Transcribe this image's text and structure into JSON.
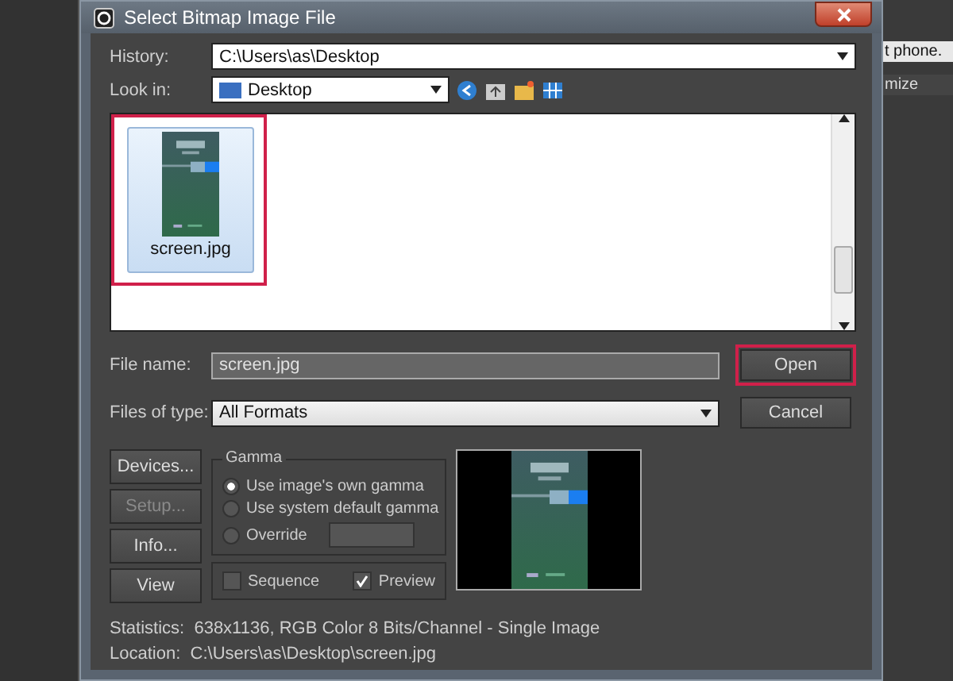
{
  "background_app": {
    "title_fragment": "t phone.",
    "panel_label": "mize"
  },
  "window": {
    "title": "Select Bitmap Image File"
  },
  "history": {
    "label": "History:",
    "value": "C:\\Users\\as\\Desktop"
  },
  "look_in": {
    "label": "Look in:",
    "value": "Desktop"
  },
  "files": [
    {
      "name": "screen.jpg",
      "kind": "picture",
      "selected": true,
      "annotated": true
    }
  ],
  "file_name": {
    "label": "File name:",
    "value": "screen.jpg"
  },
  "files_of_type": {
    "label": "Files of type:",
    "value": "All Formats"
  },
  "actions": [
    {
      "label": "Open",
      "annotated": true
    },
    {
      "label": "Cancel",
      "annotated": false
    }
  ],
  "side_buttons": [
    {
      "label": "Devices...",
      "disabled": false
    },
    {
      "label": "Setup...",
      "disabled": true
    },
    {
      "label": "Info...",
      "disabled": false
    },
    {
      "label": "View",
      "disabled": false
    }
  ],
  "gamma": {
    "title": "Gamma",
    "options": [
      {
        "label": "Use image's own gamma",
        "selected": true
      },
      {
        "label": "Use system default gamma",
        "selected": false
      },
      {
        "label": "Override",
        "selected": false
      }
    ]
  },
  "checkboxes": [
    {
      "label": "Sequence",
      "checked": false
    },
    {
      "label": "Preview",
      "checked": true
    }
  ],
  "statistics": {
    "label": "Statistics:",
    "value": "638x1136, RGB Color 8 Bits/Channel - Single Image"
  },
  "location": {
    "label": "Location:",
    "value": "C:\\Users\\as\\Desktop\\screen.jpg"
  }
}
